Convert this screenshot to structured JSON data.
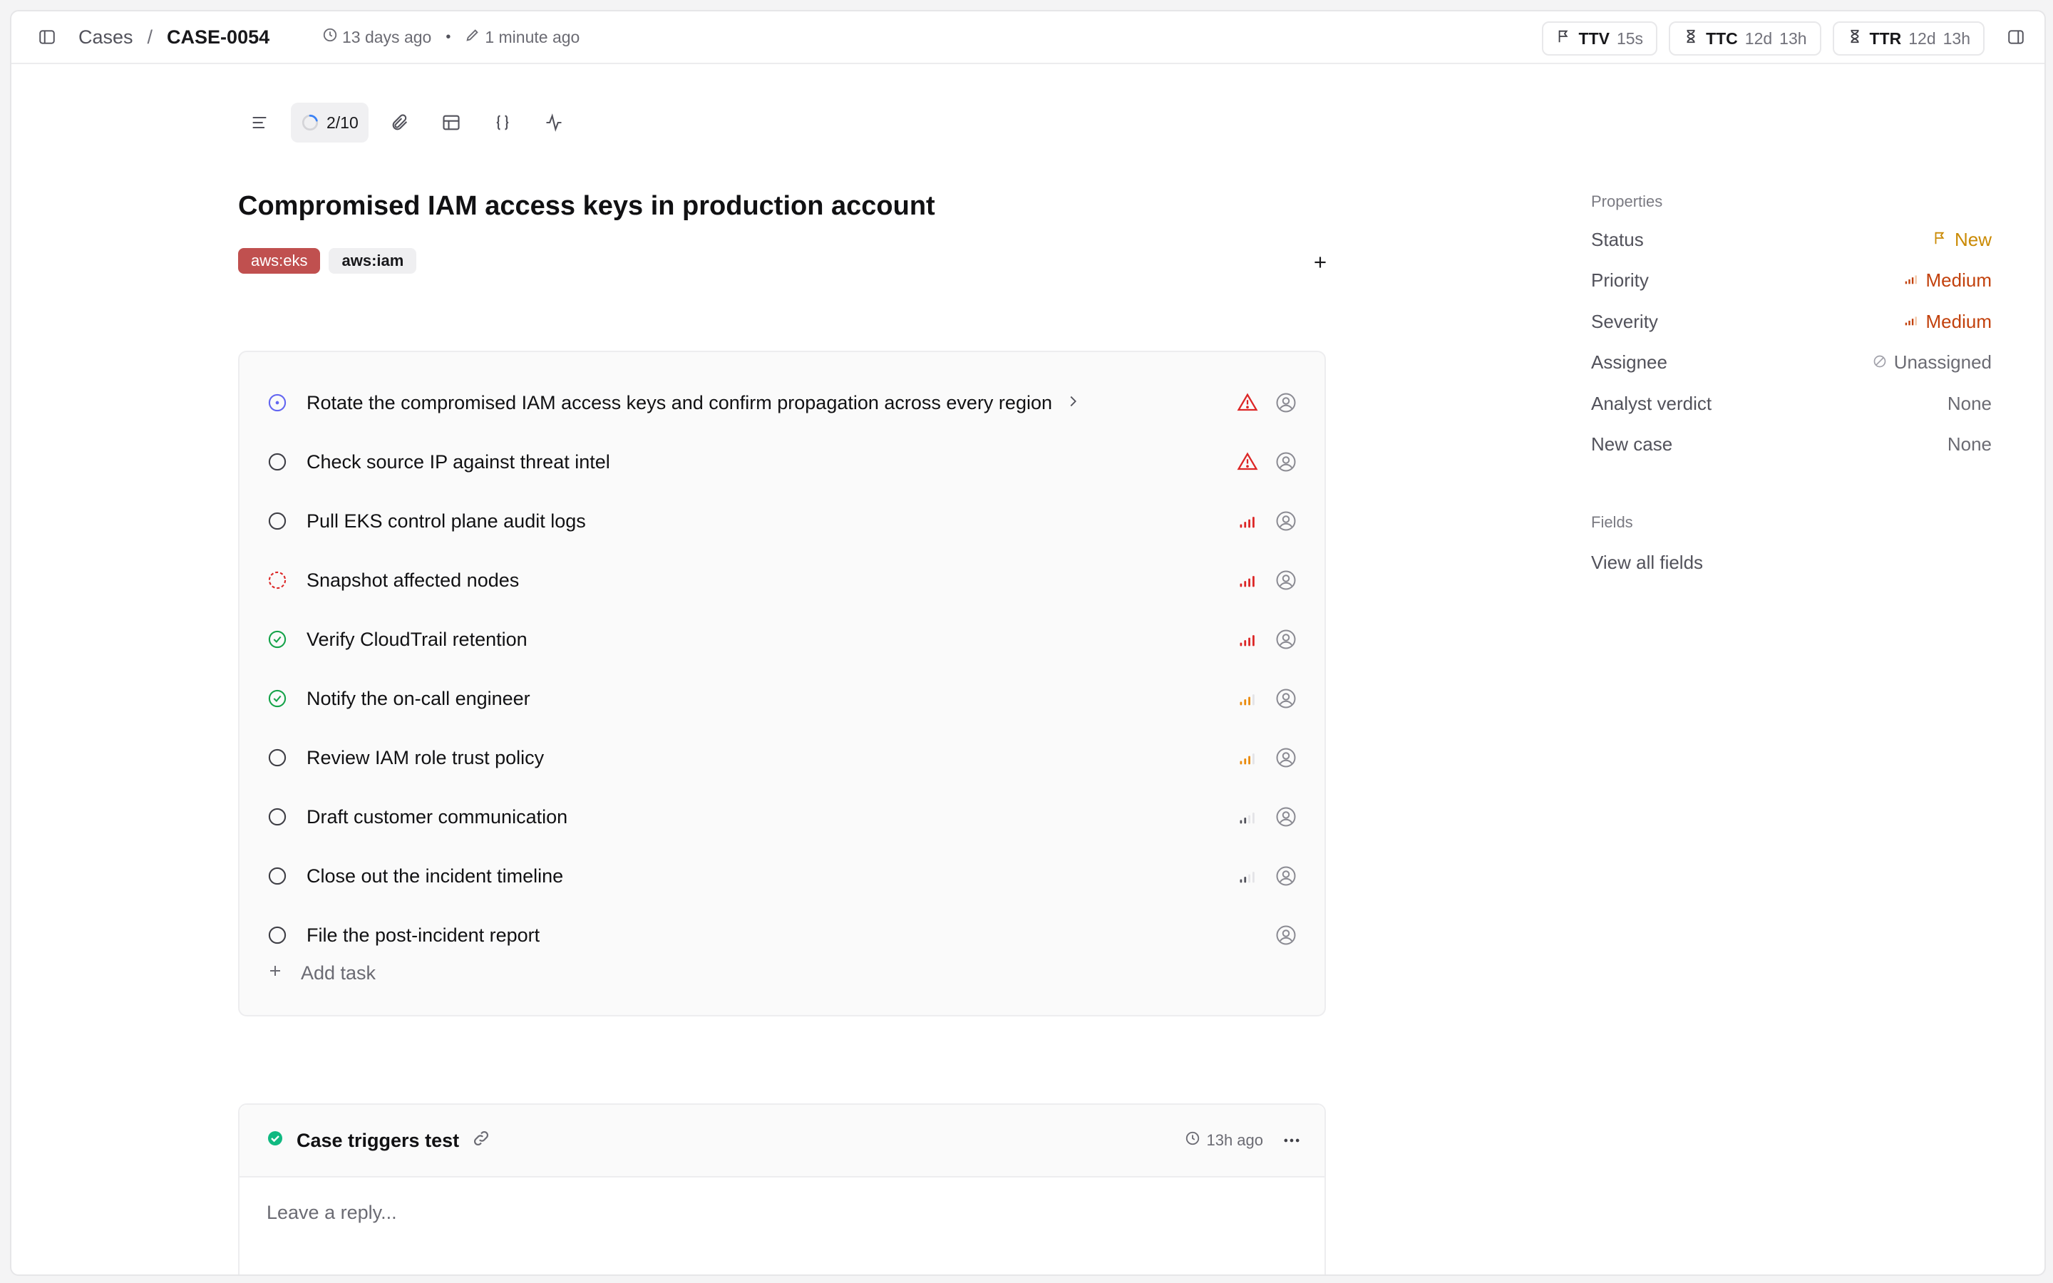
{
  "breadcrumb": {
    "root": "Cases",
    "separator": "/",
    "case_id": "CASE-0054"
  },
  "meta": {
    "created": "13 days ago",
    "updated": "1 minute ago",
    "separator": "•"
  },
  "sla": [
    {
      "label": "TTV",
      "values": [
        "15s"
      ],
      "icon": "flag-icon"
    },
    {
      "label": "TTC",
      "values": [
        "12d",
        "13h"
      ],
      "icon": "hourglass-icon"
    },
    {
      "label": "TTR",
      "values": [
        "12d",
        "13h"
      ],
      "icon": "hourglass-icon"
    }
  ],
  "toolbar": {
    "progress": "2/10",
    "progress_fraction": 0.2
  },
  "case": {
    "title": "Compromised IAM access keys in production account",
    "tags": [
      {
        "label": "aws:eks",
        "color": "#c0504f"
      },
      {
        "label": "aws:iam",
        "color": "#efeff1"
      }
    ]
  },
  "tasks": [
    {
      "label": "Rotate the compromised IAM access keys and confirm propagation across every region",
      "status": "in-progress",
      "priority": "urgent",
      "has_chevron": true
    },
    {
      "label": "Check source IP against threat intel",
      "status": "todo",
      "priority": "urgent"
    },
    {
      "label": "Pull EKS control plane audit logs",
      "status": "todo",
      "priority": "high"
    },
    {
      "label": "Snapshot affected nodes",
      "status": "blocked",
      "priority": "high"
    },
    {
      "label": "Verify CloudTrail retention",
      "status": "done",
      "priority": "high"
    },
    {
      "label": "Notify the on-call engineer",
      "status": "done",
      "priority": "medium"
    },
    {
      "label": "Review IAM role trust policy",
      "status": "todo",
      "priority": "medium"
    },
    {
      "label": "Draft customer communication",
      "status": "todo",
      "priority": "low"
    },
    {
      "label": "Close out the incident timeline",
      "status": "todo",
      "priority": "low"
    },
    {
      "label": "File the post-incident report",
      "status": "todo",
      "priority": "none"
    }
  ],
  "add_task_label": "Add task",
  "comment": {
    "title": "Case triggers test",
    "time": "13h ago",
    "reply_placeholder": "Leave a reply..."
  },
  "properties": {
    "heading": "Properties",
    "rows": [
      {
        "key": "Status",
        "value": "New",
        "style": "amber",
        "icon": "flag-icon"
      },
      {
        "key": "Priority",
        "value": "Medium",
        "style": "orange",
        "icon": "signal-icon"
      },
      {
        "key": "Severity",
        "value": "Medium",
        "style": "orange",
        "icon": "signal-icon"
      },
      {
        "key": "Assignee",
        "value": "Unassigned",
        "style": "gray",
        "icon": "unassigned-icon"
      },
      {
        "key": "Analyst verdict",
        "value": "None",
        "style": "gray"
      },
      {
        "key": "New case",
        "value": "None",
        "style": "gray"
      }
    ]
  },
  "fields": {
    "heading": "Fields",
    "view_all": "View all fields"
  },
  "colors": {
    "urgent": "#dc2626",
    "high": "#dc2626",
    "medium": "#ea8a0c",
    "low": "#52525b",
    "done": "#16a34a",
    "in_progress": "#6366f1",
    "accent_orange": "#c2410c"
  }
}
